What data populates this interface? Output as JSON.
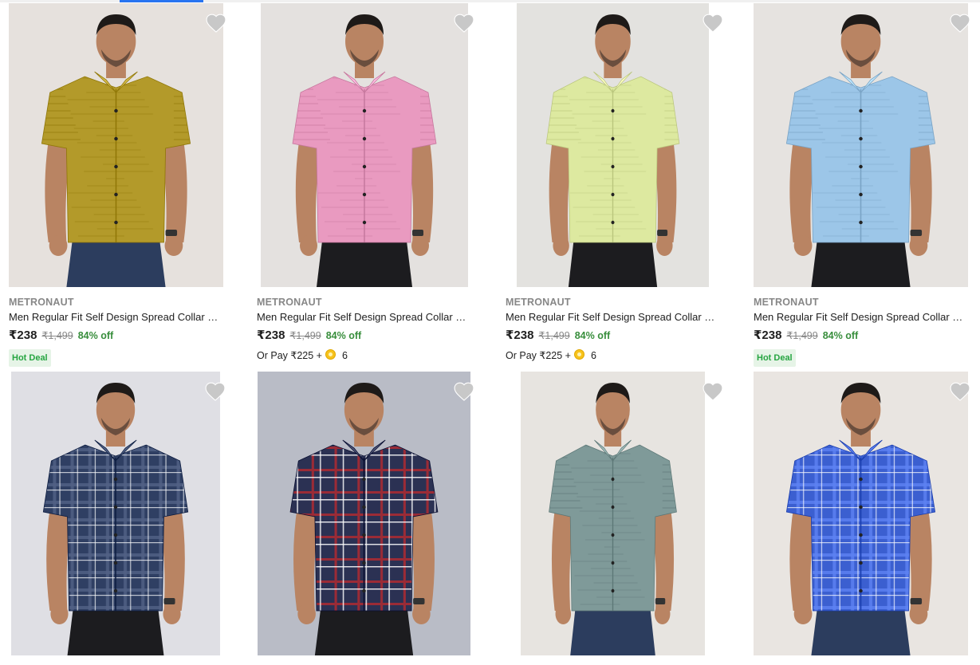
{
  "products": [
    {
      "brand": "METRONAUT",
      "title": "Men Regular Fit Self Design Spread Collar Ca...",
      "price": "₹238",
      "mrp": "₹1,499",
      "discount": "84% off",
      "badge": "Hot Deal",
      "shirt_color": "#b39a2a",
      "pattern": "texture"
    },
    {
      "brand": "METRONAUT",
      "title": "Men Regular Fit Self Design Spread Collar Ca...",
      "price": "₹238",
      "mrp": "₹1,499",
      "discount": "84% off",
      "or_pay": "Or Pay ₹225 +",
      "coins": "6",
      "shirt_color": "#e99ac0",
      "pattern": "texture"
    },
    {
      "brand": "METRONAUT",
      "title": "Men Regular Fit Self Design Spread Collar Ca...",
      "price": "₹238",
      "mrp": "₹1,499",
      "discount": "84% off",
      "or_pay": "Or Pay ₹225 +",
      "coins": "6",
      "shirt_color": "#dde9a0",
      "pattern": "texture"
    },
    {
      "brand": "METRONAUT",
      "title": "Men Regular Fit Self Design Spread Collar Ca...",
      "price": "₹238",
      "mrp": "₹1,499",
      "discount": "84% off",
      "badge": "Hot Deal",
      "shirt_color": "#9cc6e8",
      "pattern": "texture"
    },
    {
      "shirt_color": "#2f3f63",
      "pattern": "check"
    },
    {
      "shirt_color": "#2b3153",
      "pattern": "check-red"
    },
    {
      "shirt_color": "#7f9a99",
      "pattern": "texture"
    },
    {
      "shirt_color": "#3b5fd0",
      "pattern": "check"
    }
  ],
  "icons": {
    "wishlist": "heart-icon",
    "coin": "supercoin-icon"
  },
  "colors": {
    "discount": "#388e3c",
    "badge_bg": "#e6f4e7",
    "accent": "#2874f0"
  }
}
